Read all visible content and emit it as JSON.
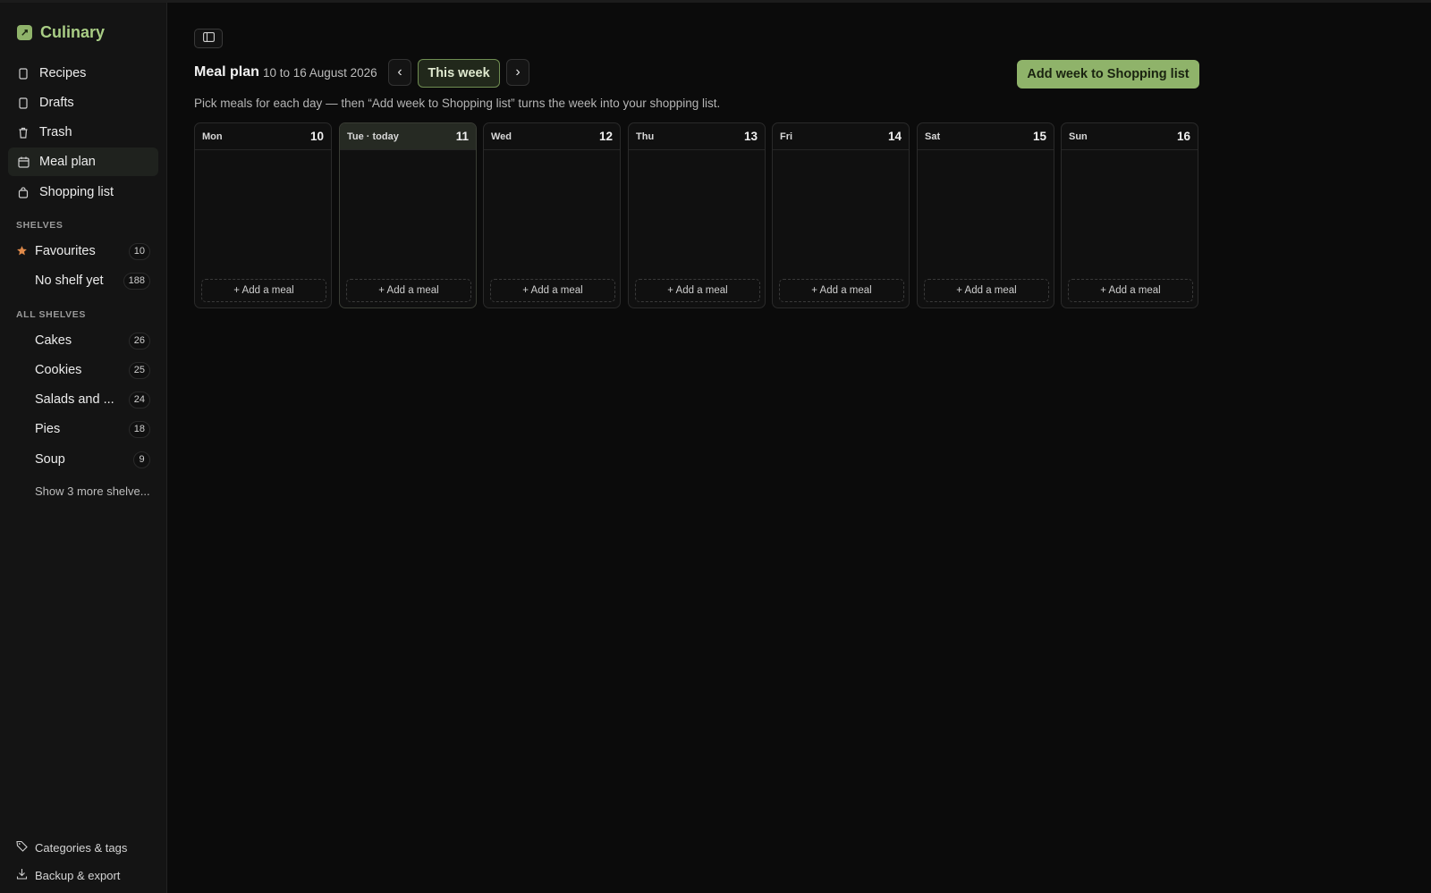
{
  "app": {
    "name": "Culinary"
  },
  "sidebar": {
    "nav": [
      {
        "label": "Recipes",
        "icon": "recipe-icon"
      },
      {
        "label": "Drafts",
        "icon": "draft-icon"
      },
      {
        "label": "Trash",
        "icon": "trash-icon"
      },
      {
        "label": "Meal plan",
        "icon": "calendar-icon",
        "active": true
      },
      {
        "label": "Shopping list",
        "icon": "shopping-bag-icon"
      }
    ],
    "shelves_label": "SHELVES",
    "shelves": [
      {
        "label": "Favourites",
        "count": "10",
        "icon": "star-icon"
      },
      {
        "label": "No shelf yet",
        "count": "188"
      }
    ],
    "all_shelves_label": "ALL SHELVES",
    "all_shelves": [
      {
        "label": "Cakes",
        "count": "26"
      },
      {
        "label": "Cookies",
        "count": "25"
      },
      {
        "label": "Salads and ...",
        "count": "24"
      },
      {
        "label": "Pies",
        "count": "18"
      },
      {
        "label": "Soup",
        "count": "9"
      }
    ],
    "show_more": "Show 3 more shelve...",
    "footer": [
      {
        "label": "Categories & tags",
        "icon": "tag-icon"
      },
      {
        "label": "Backup & export",
        "icon": "download-icon"
      }
    ]
  },
  "main": {
    "title": "Meal plan",
    "range": "10 to 16 August 2026",
    "prev": "‹",
    "next": "›",
    "this_week": "This week",
    "add_week_button": "Add week to Shopping list",
    "hint": "Pick meals for each day — then “Add week to Shopping list” turns the week into your shopping list.",
    "add_meal_label": "+ Add a meal",
    "days": [
      {
        "name": "Mon",
        "num": "10"
      },
      {
        "name": "Tue · today",
        "num": "11",
        "today": true
      },
      {
        "name": "Wed",
        "num": "12"
      },
      {
        "name": "Thu",
        "num": "13"
      },
      {
        "name": "Fri",
        "num": "14"
      },
      {
        "name": "Sat",
        "num": "15"
      },
      {
        "name": "Sun",
        "num": "16"
      }
    ]
  },
  "colors": {
    "accent": "#8fb36a",
    "brand_text": "#a9cd85",
    "star": "#e08a4a",
    "background": "#0b0b0b",
    "sidebar": "#141414"
  }
}
